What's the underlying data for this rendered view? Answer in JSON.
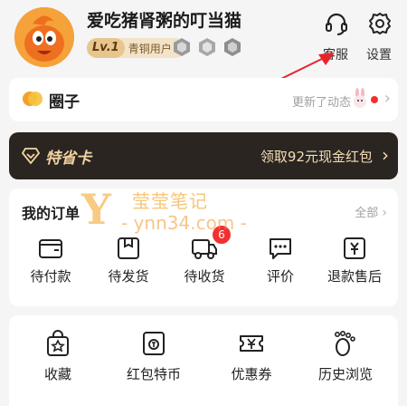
{
  "header": {
    "username": "爱吃猪肾粥的叮当猫",
    "level_badge": "Lv.1",
    "level_name": "青铜用户",
    "level_arrow": "›",
    "customer_service_label": "客服",
    "settings_label": "设置"
  },
  "circle": {
    "title": "圈子",
    "update_text": "更新了动态",
    "chevron": "›"
  },
  "vip": {
    "title": "特省卡",
    "offer": "领取92元现金红包",
    "chevron": "›"
  },
  "orders": {
    "title": "我的订单",
    "all_label": "全部",
    "chevron": "›",
    "items": [
      {
        "label": "待付款"
      },
      {
        "label": "待发货"
      },
      {
        "label": "待收货",
        "badge": "6"
      },
      {
        "label": "评价"
      },
      {
        "label": "退款售后"
      }
    ]
  },
  "tools": {
    "items": [
      {
        "label": "收藏"
      },
      {
        "label": "红包特币"
      },
      {
        "label": "优惠券"
      },
      {
        "label": "历史浏览"
      }
    ]
  },
  "watermark": {
    "letter": "Y",
    "cn": "莹莹笔记",
    "url": "- ynn34.com -"
  },
  "colors": {
    "accent_red": "#f23030",
    "vip_bg": "#2a2520",
    "vip_text": "#f2d3a0"
  }
}
